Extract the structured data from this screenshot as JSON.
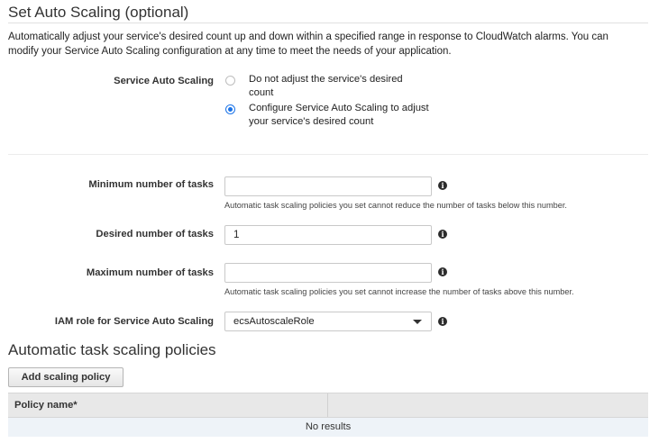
{
  "set_auto_scaling": {
    "title": "Set Auto Scaling (optional)",
    "description": "Automatically adjust your service's desired count up and down within a specified range in response to CloudWatch alarms. You can modify your Service Auto Scaling configuration at any time to meet the needs of your application.",
    "service_auto_scaling_label": "Service Auto Scaling",
    "options": [
      {
        "label": "Do not adjust the service's desired count",
        "selected": false
      },
      {
        "label": "Configure Service Auto Scaling to adjust your service's desired count",
        "selected": true
      }
    ]
  },
  "tasks": {
    "min_label": "Minimum number of tasks",
    "min_value": "",
    "min_help": "Automatic task scaling policies you set cannot reduce the number of tasks below this number.",
    "desired_label": "Desired number of tasks",
    "desired_value": "1",
    "max_label": "Maximum number of tasks",
    "max_value": "",
    "max_help": "Automatic task scaling policies you set cannot increase the number of tasks above this number.",
    "iam_label": "IAM role for Service Auto Scaling",
    "iam_value": "ecsAutoscaleRole"
  },
  "policies": {
    "title": "Automatic task scaling policies",
    "add_button": "Add scaling policy",
    "column_policy_name": "Policy name*",
    "empty_text": "No results"
  },
  "icons": {
    "info": "info-icon",
    "dropdown": "chevron-down-icon"
  },
  "colors": {
    "accent": "#1a73e8"
  }
}
